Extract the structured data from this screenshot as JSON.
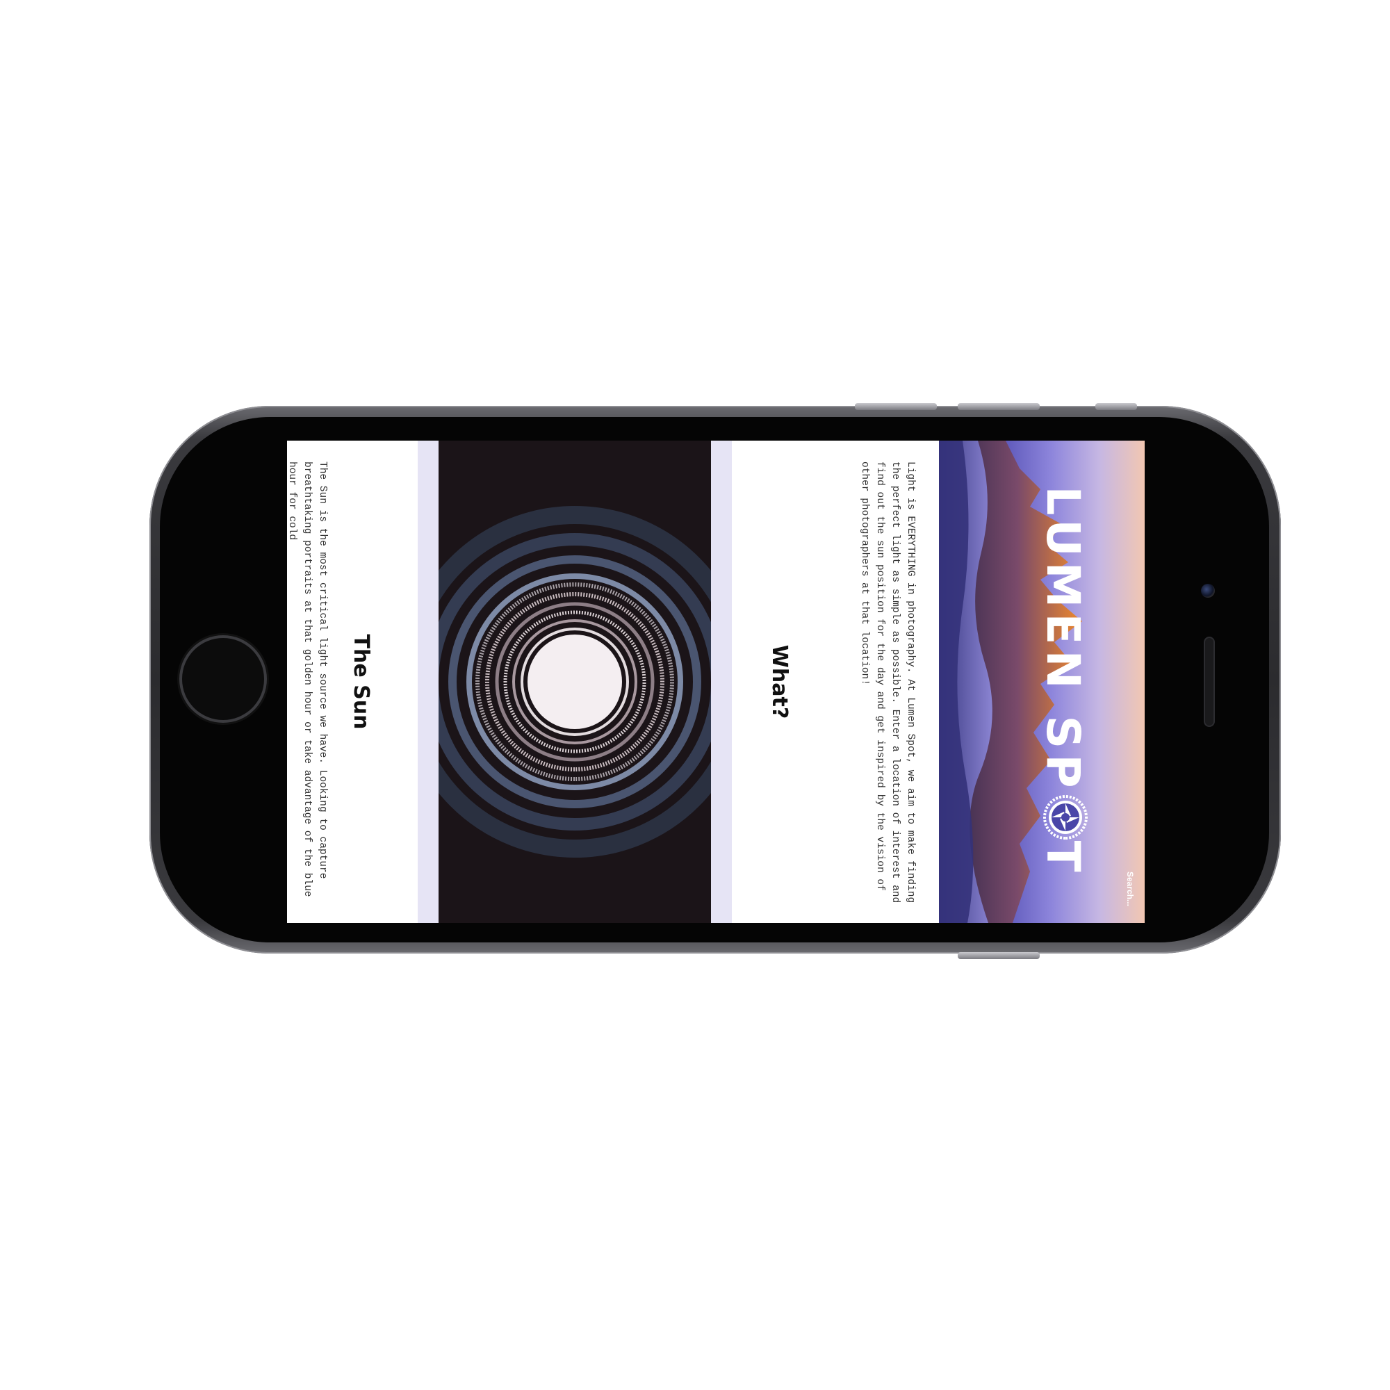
{
  "device": {
    "type": "smartphone-landscape",
    "colors": {
      "body": "#2b2b2e",
      "bezel": "#050505",
      "buttons": "#a9a9ae"
    }
  },
  "site": {
    "brand": {
      "before_lens": "LUMEN SP",
      "after_lens": "T"
    },
    "search": {
      "placeholder": "Search..."
    },
    "colors": {
      "accent_band": "#e6e4f5",
      "hero_sky": "#8e86dc",
      "text": "#111111"
    },
    "sections": {
      "what": {
        "heading": "What?",
        "body": "Light is EVERYTHING in photography. At Lumen Spot, we aim to make finding the perfect light as simple as possible. Enter a location of interest and find out the sun position for the day and get inspired by the vision of other photographers at that location!"
      },
      "sun": {
        "heading": "The Sun",
        "body": "The Sun is the most critical light source we have. Looking to capture breathtaking portraits at that golden hour or take advantage of the blue hour for cold"
      }
    },
    "icons": [
      "aperture-logo-icon"
    ]
  }
}
